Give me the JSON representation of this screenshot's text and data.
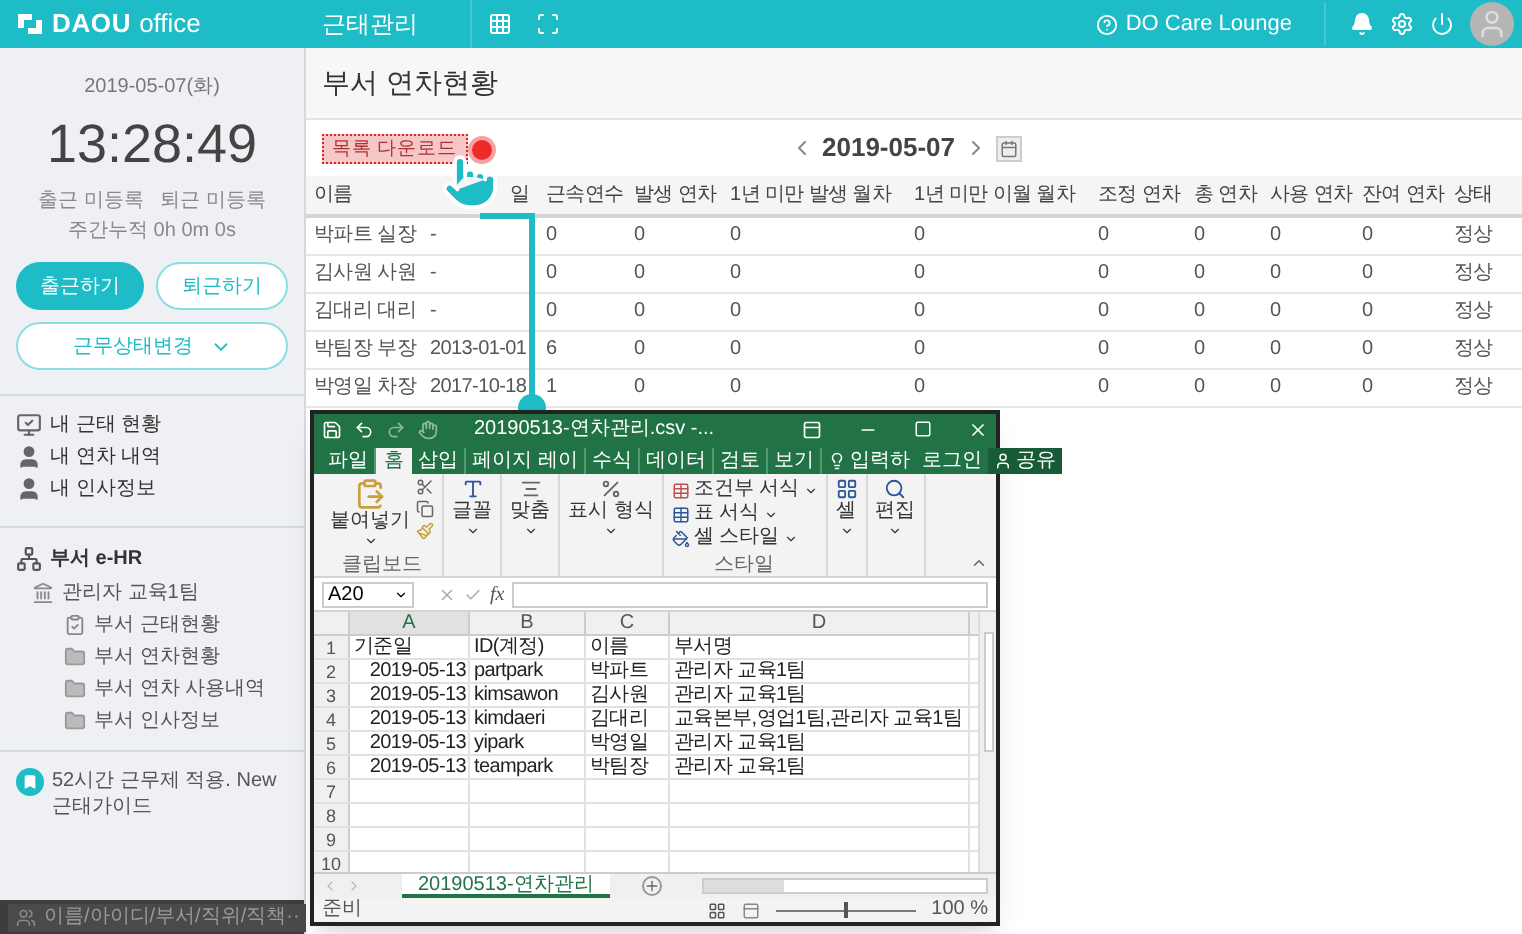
{
  "header": {
    "logo": "DAOU",
    "logo_suffix": "office",
    "app_title": "근태관리",
    "help_link": "DO Care Lounge"
  },
  "sidebar": {
    "date": "2019-05-07(화)",
    "clock": "13:28:49",
    "clock_in_status": "출근 미등록",
    "clock_out_status": "퇴근 미등록",
    "weekly_total": "주간누적 0h 0m 0s",
    "buttons": [
      {
        "label": "출근하기",
        "kind": "primary"
      },
      {
        "label": "퇴근하기",
        "kind": "outline"
      }
    ],
    "status_dropdown": "근무상태변경",
    "my_menu": [
      {
        "label": "내 근태 현황",
        "kind": "attendance"
      },
      {
        "label": "내 연차 내역",
        "kind": "person"
      },
      {
        "label": "내 인사정보",
        "kind": "person"
      }
    ],
    "dept": {
      "title": "부서 e-HR",
      "children": [
        {
          "label": "관리자 교육1팀",
          "kind": "team",
          "children": [
            {
              "label": "부서 근태현황",
              "kind": "report"
            },
            {
              "label": "부서 연차현황",
              "kind": "folder"
            },
            {
              "label": "부서 연차 사용내역",
              "kind": "folder"
            },
            {
              "label": "부서 인사정보",
              "kind": "folder"
            }
          ]
        }
      ]
    },
    "notice": "52시간 근무제 적용. New 근태가이드",
    "search": {
      "placeholder": "이름/아이디/부서/직위/직책···"
    }
  },
  "page": {
    "title": "부서 연차현황",
    "download_button": "목록 다운로드",
    "date": "2019-05-07",
    "table": {
      "columns": [
        "이름",
        "일",
        "근속연수",
        "발생 연차",
        "1년 미만 발생 월차",
        "1년 미만 이월 월차",
        "조정 연차",
        "총 연차",
        "사용 연차",
        "잔여 연차",
        "상태"
      ],
      "rows": [
        [
          "박파트 실장",
          "-",
          "0",
          "0",
          "0",
          "0",
          "0",
          "0",
          "0",
          "0",
          "정상"
        ],
        [
          "김사원 사원",
          "-",
          "0",
          "0",
          "0",
          "0",
          "0",
          "0",
          "0",
          "0",
          "정상"
        ],
        [
          "김대리 대리",
          "-",
          "0",
          "0",
          "0",
          "0",
          "0",
          "0",
          "0",
          "0",
          "정상"
        ],
        [
          "박팀장 부장",
          "2013-01-01",
          "6",
          "0",
          "0",
          "0",
          "0",
          "0",
          "0",
          "0",
          "정상"
        ],
        [
          "박영일 차장",
          "2017-10-18",
          "1",
          "0",
          "0",
          "0",
          "0",
          "0",
          "0",
          "0",
          "정상"
        ]
      ]
    }
  },
  "spreadsheet": {
    "title": "20190513-연차관리.csv -...",
    "ribbon_tabs": [
      {
        "label": "파일",
        "selected": false
      },
      {
        "label": "홈",
        "selected": true
      },
      {
        "label": "삽입",
        "selected": false
      },
      {
        "label": "페이지 레이",
        "selected": false
      },
      {
        "label": "수식",
        "selected": false
      },
      {
        "label": "데이터",
        "selected": false
      },
      {
        "label": "검토",
        "selected": false
      },
      {
        "label": "보기",
        "selected": false
      }
    ],
    "ribbon_right": [
      {
        "label": "입력하",
        "kind": "tell"
      },
      {
        "label": "로그인",
        "kind": "signin"
      },
      {
        "label": "공유",
        "kind": "share"
      }
    ],
    "groups": [
      {
        "label": "클립보드",
        "kind": "clipboard",
        "commands": [
          "붙여넣기"
        ]
      },
      {
        "kind": "font",
        "commands": [
          "글꼴"
        ]
      },
      {
        "kind": "align",
        "commands": [
          "맞춤"
        ]
      },
      {
        "kind": "number",
        "commands": [
          "표시 형식"
        ]
      },
      {
        "label": "스타일",
        "kind": "styles",
        "commands": [
          "조건부 서식",
          "표 서식",
          "셀 스타일"
        ]
      },
      {
        "kind": "cells",
        "commands": [
          "셀"
        ]
      },
      {
        "kind": "editing",
        "commands": [
          "편집"
        ]
      }
    ],
    "name_box": "A20",
    "function_label": "fx",
    "columns": [
      "A",
      "B",
      "C",
      "D"
    ],
    "rows": [
      {
        "number": "1",
        "cells": [
          "기준일",
          "ID(계정)",
          "이름",
          "부서명"
        ]
      },
      {
        "number": "2",
        "cells": [
          "2019-05-13",
          "partpark",
          "박파트",
          "관리자 교육1팀"
        ]
      },
      {
        "number": "3",
        "cells": [
          "2019-05-13",
          "kimsawon",
          "김사원",
          "관리자 교육1팀"
        ]
      },
      {
        "number": "4",
        "cells": [
          "2019-05-13",
          "kimdaeri",
          "김대리",
          "교육본부,영업1팀,관리자 교육1팀"
        ]
      },
      {
        "number": "5",
        "cells": [
          "2019-05-13",
          "yipark",
          "박영일",
          "관리자 교육1팀"
        ]
      },
      {
        "number": "6",
        "cells": [
          "2019-05-13",
          "teampark",
          "박팀장",
          "관리자 교육1팀"
        ]
      },
      {
        "number": "7",
        "cells": []
      },
      {
        "number": "8",
        "cells": []
      },
      {
        "number": "9",
        "cells": []
      },
      {
        "number": "10",
        "cells": []
      }
    ],
    "sheets": [
      {
        "label": "20190513-연차관리",
        "selected": true
      }
    ],
    "status": "준비",
    "zoom_slider": {
      "level": 0.5
    },
    "zoom": "100 %"
  }
}
